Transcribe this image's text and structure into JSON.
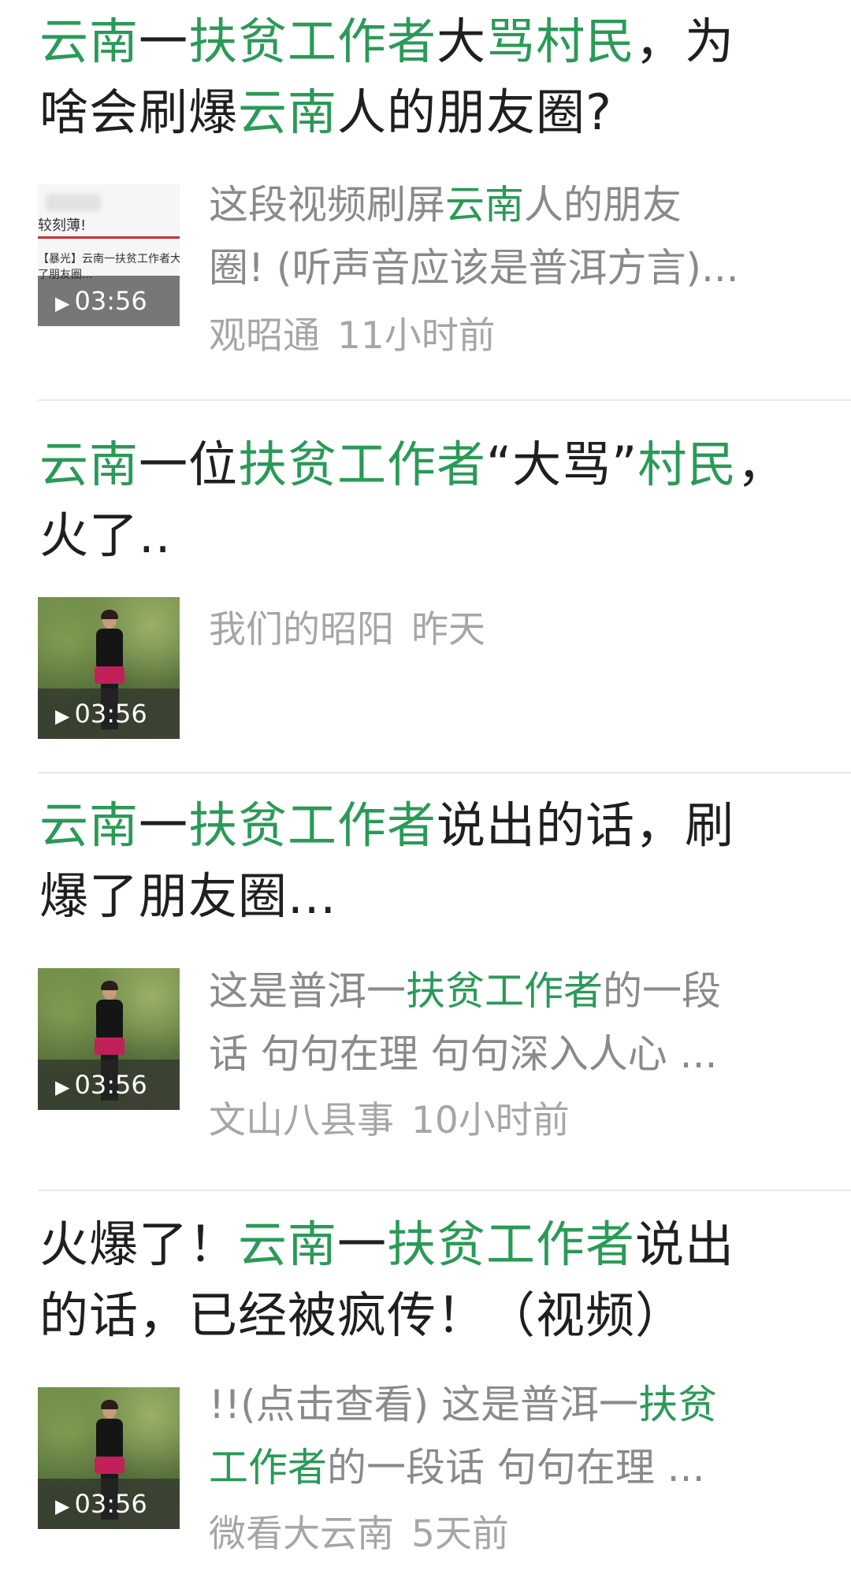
{
  "results": [
    {
      "title": [
        {
          "text": "云南",
          "hl": true
        },
        {
          "text": "一",
          "hl": false
        },
        {
          "text": "扶贫工作者",
          "hl": true
        },
        {
          "text": "大",
          "hl": false
        },
        {
          "text": "骂村民",
          "hl": true
        },
        {
          "text": "，为",
          "hl": false
        },
        {
          "text": "\n",
          "hl": false
        },
        {
          "text": "啥会刷爆",
          "hl": false
        },
        {
          "text": "云南",
          "hl": true
        },
        {
          "text": "人的朋友圈?",
          "hl": false
        }
      ],
      "description": [
        {
          "text": "这段视频刷屏",
          "hl": false
        },
        {
          "text": "云南",
          "hl": true
        },
        {
          "text": "人的朋友",
          "hl": false
        },
        {
          "text": "\n",
          "hl": false
        },
        {
          "text": "圈! (听声音应该是普洱方言)...",
          "hl": false
        }
      ],
      "source": "观昭通",
      "time": "11小时前",
      "duration": "03:56",
      "thumb_text": {
        "line1": "较刻薄!",
        "line2": "【暴光】云南一扶贫工作者大",
        "line3": "了朋友圈..."
      }
    },
    {
      "title": [
        {
          "text": "云南",
          "hl": true
        },
        {
          "text": "一位",
          "hl": false
        },
        {
          "text": "扶贫工作者",
          "hl": true
        },
        {
          "text": "“大骂”",
          "hl": false
        },
        {
          "text": "村民",
          "hl": true
        },
        {
          "text": "，",
          "hl": false
        },
        {
          "text": "\n",
          "hl": false
        },
        {
          "text": "火了..",
          "hl": false
        }
      ],
      "description": [],
      "source": "我们的昭阳",
      "time": "昨天",
      "duration": "03:56"
    },
    {
      "title": [
        {
          "text": "云南",
          "hl": true
        },
        {
          "text": "一",
          "hl": false
        },
        {
          "text": "扶贫工作者",
          "hl": true
        },
        {
          "text": "说出的话，刷",
          "hl": false
        },
        {
          "text": "\n",
          "hl": false
        },
        {
          "text": "爆了朋友圈...",
          "hl": false
        }
      ],
      "description": [
        {
          "text": "这是普洱一",
          "hl": false
        },
        {
          "text": "扶贫工作者",
          "hl": true
        },
        {
          "text": "的一段",
          "hl": false
        },
        {
          "text": "\n",
          "hl": false
        },
        {
          "text": "话 句句在理 句句深入人心 ...",
          "hl": false
        }
      ],
      "source": "文山八县事",
      "time": "10小时前",
      "duration": "03:56"
    },
    {
      "title": [
        {
          "text": "火爆了！",
          "hl": false
        },
        {
          "text": "云南",
          "hl": true
        },
        {
          "text": "一",
          "hl": false
        },
        {
          "text": "扶贫工作者",
          "hl": true
        },
        {
          "text": "说出",
          "hl": false
        },
        {
          "text": "\n",
          "hl": false
        },
        {
          "text": "的话，已经被疯传！（视频）",
          "hl": false
        }
      ],
      "description": [
        {
          "text": "!!(点击查看) 这是普洱一",
          "hl": false
        },
        {
          "text": "扶贫",
          "hl": true
        },
        {
          "text": "\n",
          "hl": false
        },
        {
          "text": "工作者",
          "hl": true
        },
        {
          "text": "的一段话 句句在理 ...",
          "hl": false
        }
      ],
      "source": "微看大云南",
      "time": "5天前",
      "duration": "03:56"
    }
  ],
  "colors": {
    "highlight": "#2a9a57",
    "title": "#1f1f1f",
    "description": "#8a8a8a",
    "meta": "#a6a6a6"
  },
  "icons": {
    "play": "play-icon"
  }
}
